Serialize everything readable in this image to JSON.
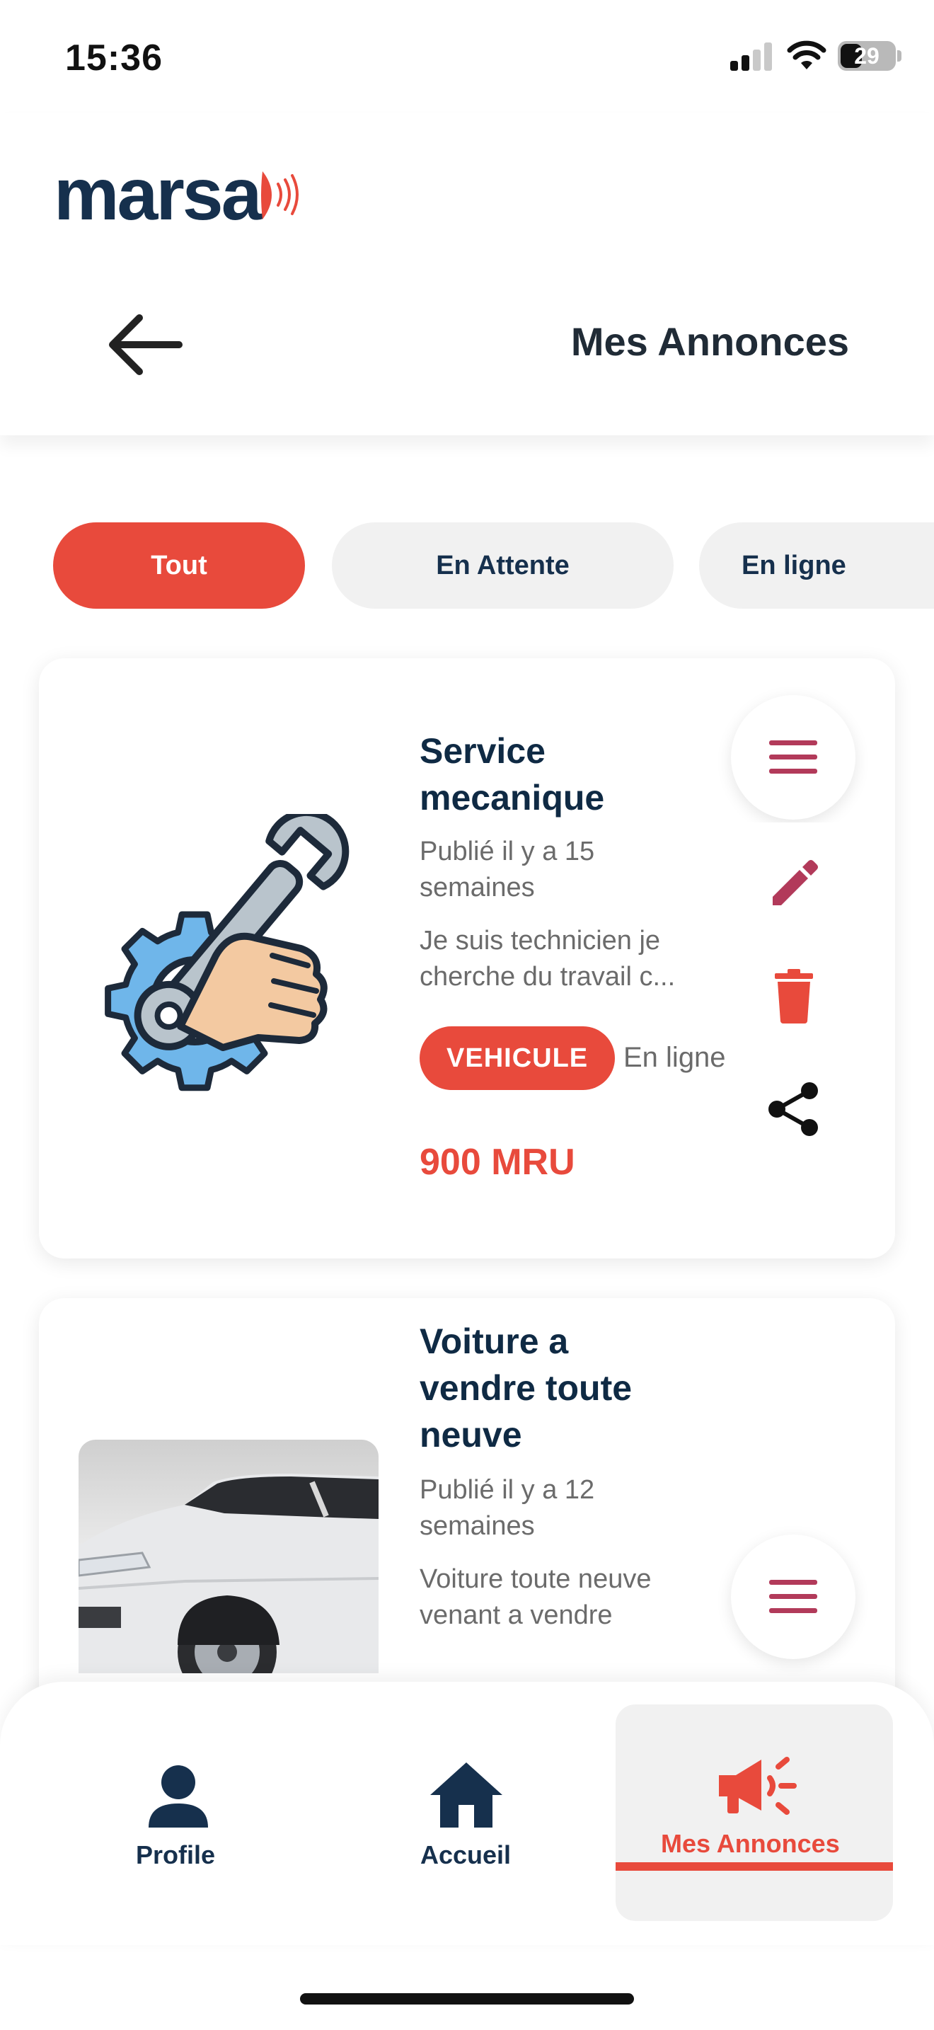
{
  "status_bar": {
    "time": "15:36",
    "battery": "29",
    "icons": [
      "signal-icon",
      "wifi-icon",
      "battery-icon"
    ]
  },
  "header": {
    "logo_text": "marsa",
    "title": "Mes Annonces",
    "back_icon": "arrow-left-icon"
  },
  "filters": {
    "tabs": [
      {
        "label": "Tout",
        "active": true
      },
      {
        "label": "En Attente",
        "active": false
      },
      {
        "label": "En ligne",
        "active": false
      }
    ]
  },
  "listings": [
    {
      "image_icon": "wrench-gear-icon",
      "title": "Service mecanique",
      "published": "Publié il y a 15 semaines",
      "description": "Je suis technicien je cherche du travail c...",
      "category": "VEHICULE",
      "status": "En ligne",
      "price": "900 MRU",
      "menu_open": true,
      "actions": [
        "edit-icon",
        "delete-icon",
        "share-icon"
      ]
    },
    {
      "image_icon": "car-photo",
      "title": "Voiture a vendre toute neuve",
      "published": "Publié il y a 12 semaines",
      "description": "Voiture toute neuve venant a vendre",
      "menu_open": false
    }
  ],
  "bottom_nav": {
    "items": [
      {
        "label": "Profile",
        "icon": "user-icon",
        "active": false
      },
      {
        "label": "Accueil",
        "icon": "home-icon",
        "active": false
      },
      {
        "label": "Mes Annonces",
        "icon": "megaphone-icon",
        "active": true
      }
    ]
  },
  "colors": {
    "accent": "#e84a3c",
    "navy": "#16304d",
    "menu_icon": "#b23a5a",
    "chip_idle_bg": "#f1f1f1"
  }
}
